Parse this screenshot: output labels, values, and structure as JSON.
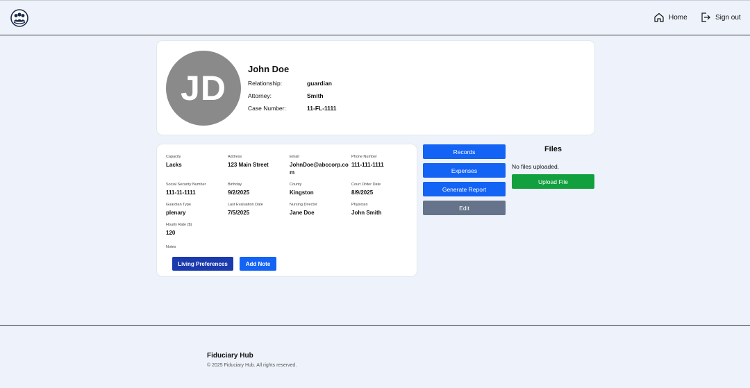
{
  "nav": {
    "home_label": "Home",
    "signout_label": "Sign out"
  },
  "profile": {
    "initials": "JD",
    "name": "John Doe",
    "rows": [
      {
        "label": "Relationship:",
        "value": "guardian"
      },
      {
        "label": "Attorney:",
        "value": "Smith"
      },
      {
        "label": "Case Number:",
        "value": "11-FL-1111"
      }
    ]
  },
  "details": {
    "fields": [
      {
        "label": "Capacity",
        "value": "Lacks"
      },
      {
        "label": "Address",
        "value": "123 Main Street"
      },
      {
        "label": "Email",
        "value": "JohnDoe@abccorp.com"
      },
      {
        "label": "Phone Number",
        "value": "111-111-1111"
      },
      {
        "label": "Social Security Number",
        "value": "111-11-1111"
      },
      {
        "label": "Birthday",
        "value": "9/2/2025"
      },
      {
        "label": "County",
        "value": "Kingston"
      },
      {
        "label": "Court Order Date",
        "value": "8/9/2025"
      },
      {
        "label": "Guardian Type",
        "value": "plenary"
      },
      {
        "label": "Last Evaluation Date",
        "value": "7/5/2025"
      },
      {
        "label": "Nursing Director",
        "value": "Jane Doe"
      },
      {
        "label": "Physician",
        "value": "John Smith"
      },
      {
        "label": "Hourly Rate ($)",
        "value": "120"
      }
    ],
    "notes_label": "Notes",
    "living_preferences_label": "Living Preferences",
    "add_note_label": "Add Note"
  },
  "actions": {
    "records_label": "Records",
    "expenses_label": "Expenses",
    "generate_report_label": "Generate Report",
    "edit_label": "Edit"
  },
  "files": {
    "title": "Files",
    "empty_text": "No files uploaded.",
    "upload_label": "Upload File"
  },
  "footer": {
    "title": "Fiduciary Hub",
    "copyright": "© 2025 Fiduciary Hub. All rights reserved."
  },
  "colors": {
    "background": "#eef3fb",
    "primary_blue": "#1363f5",
    "dark_blue": "#1a3aad",
    "gray_button": "#65748a",
    "green_button": "#12a03f",
    "avatar_gray": "#8a8a8a"
  },
  "icons": {
    "logo": "group-people-icon",
    "home": "home-icon",
    "signout": "sign-out-icon"
  }
}
